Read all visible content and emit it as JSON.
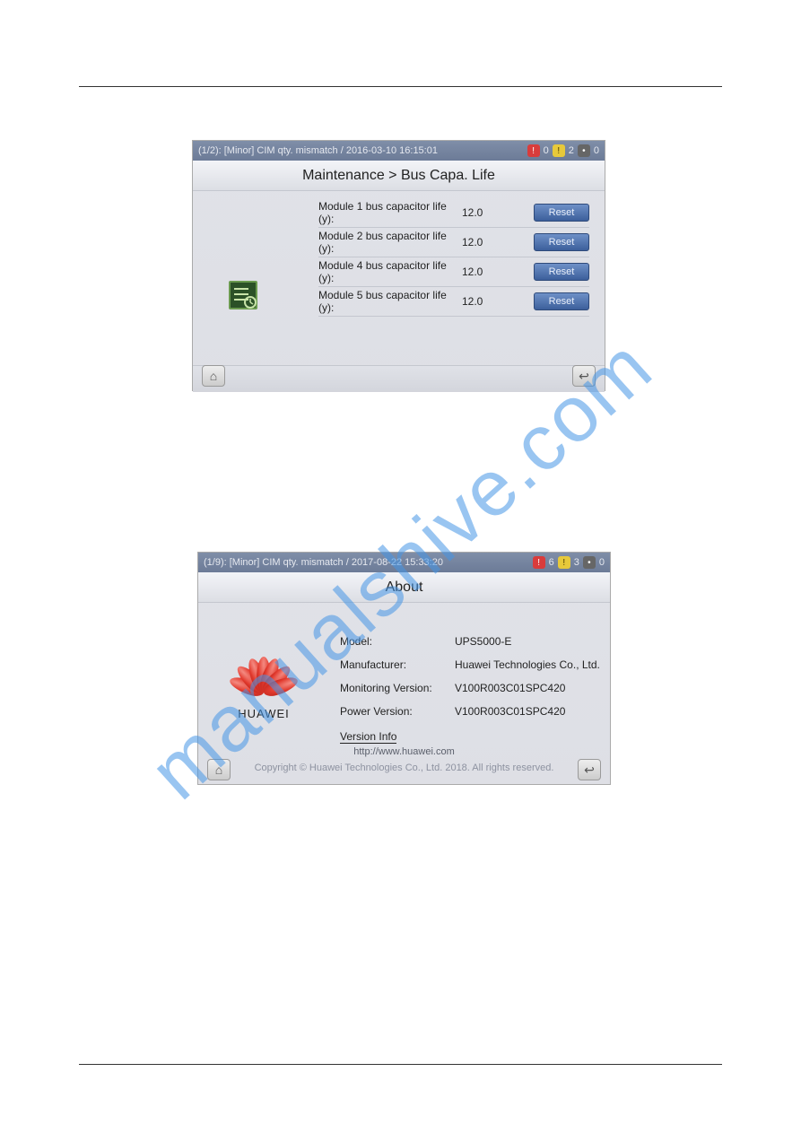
{
  "watermark": "manualshive.com",
  "screenshot1": {
    "status_text": "(1/2): [Minor] CIM qty. mismatch / 2016-03-10 16:15:01",
    "badges": {
      "red": "0",
      "yellow": "2",
      "grey": "0"
    },
    "title": "Maintenance > Bus Capa. Life",
    "rows": [
      {
        "label": "Module 1 bus capacitor life (y):",
        "value": "12.0",
        "btn": "Reset"
      },
      {
        "label": "Module 2 bus capacitor life (y):",
        "value": "12.0",
        "btn": "Reset"
      },
      {
        "label": "Module 4 bus capacitor life (y):",
        "value": "12.0",
        "btn": "Reset"
      },
      {
        "label": "Module 5 bus capacitor life (y):",
        "value": "12.0",
        "btn": "Reset"
      }
    ]
  },
  "screenshot2": {
    "status_text": "(1/9): [Minor] CIM qty. mismatch / 2017-08-22 15:33:20",
    "badges": {
      "red": "6",
      "yellow": "3",
      "grey": "0"
    },
    "title": "About",
    "logo_text": "HUAWEI",
    "info": {
      "model_label": "Model:",
      "model_value": "UPS5000-E",
      "manufacturer_label": "Manufacturer:",
      "manufacturer_value": "Huawei Technologies Co., Ltd.",
      "monitoring_label": "Monitoring Version:",
      "monitoring_value": "V100R003C01SPC420",
      "power_label": "Power Version:",
      "power_value": "V100R003C01SPC420",
      "version_info": "Version Info"
    },
    "url": "http://www.huawei.com",
    "copyright": "Copyright © Huawei Technologies Co., Ltd. 2018. All rights reserved."
  }
}
